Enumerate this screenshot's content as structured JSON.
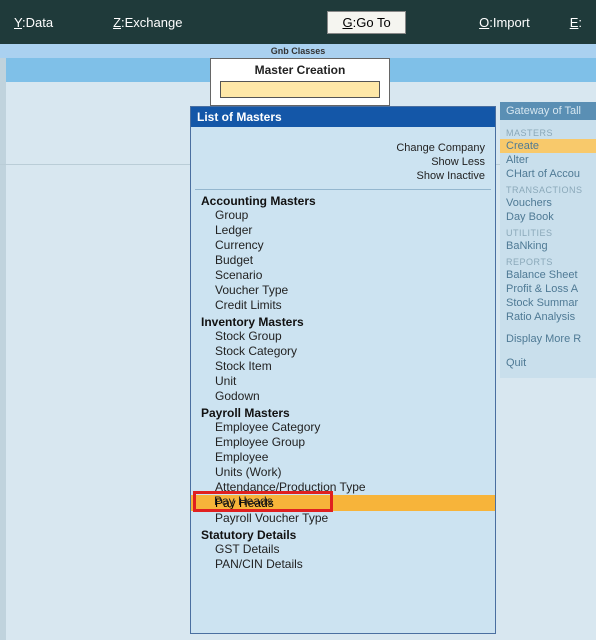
{
  "menubar": {
    "data": {
      "key": "Y",
      "label": "Data"
    },
    "exch": {
      "key": "Z",
      "label": "Exchange"
    },
    "goto": {
      "key": "G",
      "label": "Go To"
    },
    "import": {
      "key": "O",
      "label": "Import"
    },
    "extra": {
      "key": "E",
      "label": ""
    }
  },
  "substrip": {
    "label": "Gnb Classes"
  },
  "master_creation": {
    "title": "Master Creation",
    "input_value": ""
  },
  "lom": {
    "title": "List of Masters",
    "actions": {
      "change_company": "Change Company",
      "show_less": "Show Less",
      "show_inactive": "Show Inactive"
    },
    "sections": {
      "accounting": {
        "title": "Accounting Masters",
        "items": [
          "Group",
          "Ledger",
          "Currency",
          "Budget",
          "Scenario",
          "Voucher Type",
          "Credit Limits"
        ]
      },
      "inventory": {
        "title": "Inventory Masters",
        "items": [
          "Stock Group",
          "Stock Category",
          "Stock Item",
          "Unit",
          "Godown"
        ]
      },
      "payroll": {
        "title": "Payroll Masters",
        "items": [
          "Employee Category",
          "Employee Group",
          "Employee",
          "Units (Work)",
          "Attendance/Production Type",
          "Pay Heads",
          "Payroll Voucher Type"
        ]
      },
      "statutory": {
        "title": "Statutory Details",
        "items": [
          "GST Details",
          "PAN/CIN Details"
        ]
      }
    },
    "highlighted": "Pay Heads",
    "boxed": "Pay Heads"
  },
  "rsidebar": {
    "gateway_title": "Gateway of Tall",
    "groups": {
      "masters": {
        "hdr": "MASTERS",
        "items": [
          "Create",
          "Alter",
          "CHart of Accou"
        ],
        "highlight_index": 0
      },
      "transactions": {
        "hdr": "TRANSACTIONS",
        "items": [
          "Vouchers",
          "Day Book"
        ]
      },
      "utilities": {
        "hdr": "UTILITIES",
        "items": [
          "BaNking"
        ]
      },
      "reports": {
        "hdr": "REPORTS",
        "items": [
          "Balance Sheet",
          "Profit & Loss A",
          "Stock Summar",
          "Ratio Analysis"
        ]
      },
      "more": {
        "items": [
          "Display More R"
        ]
      },
      "quit": {
        "items": [
          "Quit"
        ]
      }
    }
  }
}
